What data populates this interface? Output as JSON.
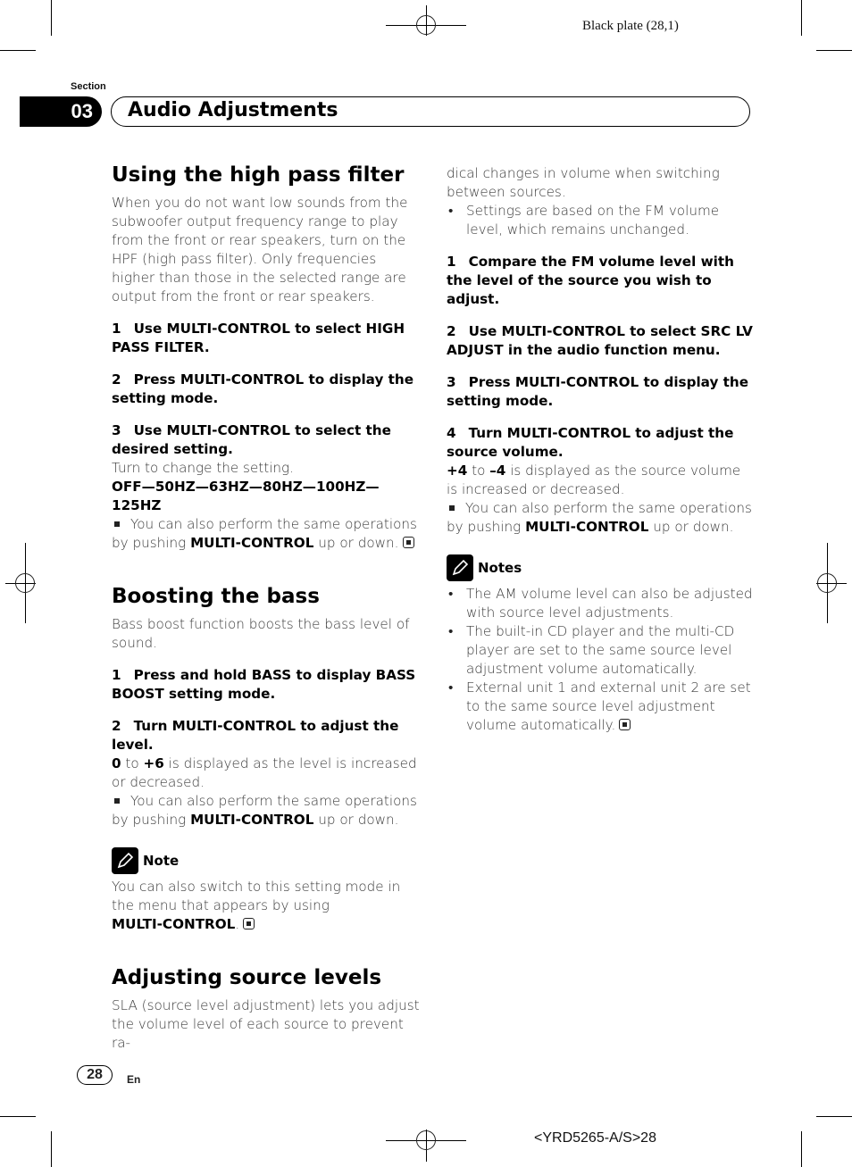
{
  "print_marks": {
    "plate_label": "Black plate (28,1)",
    "footer_code": "<YRD5265-A/S>28"
  },
  "section": {
    "label": "Section",
    "number": "03",
    "title": "Audio Adjustments"
  },
  "high_pass_filter": {
    "heading": "Using the high pass filter",
    "intro": "When you do not want low sounds from the subwoofer output frequency range to play from the front or rear speakers, turn on the HPF (high pass filter). Only frequencies higher than those in the selected range are output from the front or rear speakers.",
    "steps": [
      {
        "num": "1",
        "text": "Use MULTI-CONTROL to select HIGH PASS FILTER."
      },
      {
        "num": "2",
        "text": "Press MULTI-CONTROL to display the setting mode."
      },
      {
        "num": "3",
        "text": "Use MULTI-CONTROL to select the desired setting."
      }
    ],
    "turn_text": "Turn to change the setting.",
    "settings_sequence": "OFF—50HZ—63HZ—80HZ—100HZ—125HZ",
    "tip_prefix": "You can also perform the same operations by pushing",
    "tip_bold": "MULTI-CONTROL",
    "tip_suffix": "up or down."
  },
  "bass_boost": {
    "heading": "Boosting the bass",
    "intro": "Bass boost function boosts the bass level of sound.",
    "steps": [
      {
        "num": "1",
        "text": "Press and hold BASS to display BASS BOOST setting mode."
      },
      {
        "num": "2",
        "text": "Turn MULTI-CONTROL to adjust the level."
      }
    ],
    "range_min": "0",
    "range_to": "to",
    "range_max": "+6",
    "range_text": "is displayed as the level is increased or decreased.",
    "tip_prefix": "You can also perform the same operations by pushing",
    "tip_bold": "MULTI-CONTROL",
    "tip_suffix": "up or down.",
    "note_label": "Note",
    "note_text": "You can also switch to this setting mode in the menu that appears by using",
    "note_bold": "MULTI-CONTROL",
    "note_end": "."
  },
  "source_levels": {
    "heading": "Adjusting source levels",
    "intro_part1": "SLA (source level adjustment) lets you adjust the volume level of each source to prevent ra-",
    "intro_part2": "dical changes in volume when switching between sources.",
    "bullet": "Settings are based on the FM volume level, which remains unchanged.",
    "steps": [
      {
        "num": "1",
        "text": "Compare the FM volume level with the level of the source you wish to adjust."
      },
      {
        "num": "2",
        "text": "Use MULTI-CONTROL to select SRC LV ADJUST in the audio function menu."
      },
      {
        "num": "3",
        "text": "Press MULTI-CONTROL to display the setting mode."
      },
      {
        "num": "4",
        "text": "Turn MULTI-CONTROL to adjust the source volume."
      }
    ],
    "range_max": "+4",
    "range_to": "to",
    "range_min": "–4",
    "range_text": "is displayed as the source volume is increased or decreased.",
    "tip_prefix": "You can also perform the same operations by pushing",
    "tip_bold": "MULTI-CONTROL",
    "tip_suffix": "up or down.",
    "notes_label": "Notes",
    "notes": [
      "The AM volume level can also be adjusted with source level adjustments.",
      "The built-in CD player and the multi-CD player are set to the same source level adjustment volume automatically.",
      "External unit 1 and external unit 2 are set to the same source level adjustment volume automatically."
    ]
  },
  "footer": {
    "page_number": "28",
    "language": "En"
  }
}
